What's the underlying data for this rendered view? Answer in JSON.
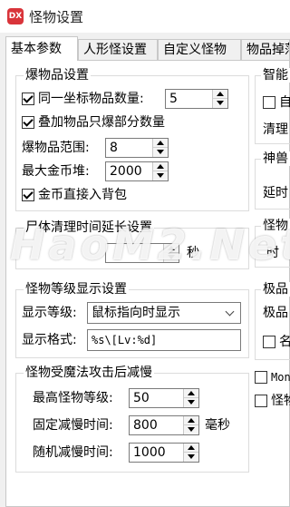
{
  "window": {
    "title": "怪物设置",
    "icon_text": "DX"
  },
  "tabs": [
    {
      "label": "基本参数",
      "active": true
    },
    {
      "label": "人形怪设置",
      "active": false
    },
    {
      "label": "自定义怪物",
      "active": false
    },
    {
      "label": "物品掉落",
      "active": false
    }
  ],
  "explode_group": {
    "title": "爆物品设置",
    "same_coord": {
      "label": "同一坐标物品数量:",
      "checked": true,
      "value": "5"
    },
    "stack_partial": {
      "label": "叠加物品只爆部分数量",
      "checked": true
    },
    "range": {
      "label": "爆物品范围:",
      "value": "8"
    },
    "max_gold": {
      "label": "最大金币堆:",
      "value": "2000"
    },
    "gold_to_bag": {
      "label": "金币直接入背包",
      "checked": true
    }
  },
  "right_clipped": {
    "smart_title": "智能",
    "smart_cb_label": "自",
    "cleanup_label": "清理",
    "beast_title": "神兽",
    "delay_label": "延时",
    "monster_title": "怪物",
    "time_label": "时",
    "item_title": "极品",
    "item_label": "极品",
    "name_cb_label": "名"
  },
  "corpse_group": {
    "title": "尸体清理时间延长设置",
    "partial_row": "秒",
    "watermark": "HaoM2.Net"
  },
  "level_group": {
    "title": "怪物等级显示设置",
    "display_label": "显示等级:",
    "display_value": "鼠标指向时显示",
    "format_label": "显示格式:",
    "format_value": "%s\\[Lv:%d]"
  },
  "slow_group": {
    "title": "怪物受魔法攻击后减慢",
    "max_level": {
      "label": "最高怪物等级:",
      "value": "50"
    },
    "fixed_time": {
      "label": "固定减慢时间:",
      "value": "800",
      "unit": "毫秒"
    },
    "random_time": {
      "label": "随机减慢时间:",
      "value": "1000"
    }
  },
  "bottom_right": {
    "mon_label": "MonS",
    "monster_label": "怪物"
  }
}
